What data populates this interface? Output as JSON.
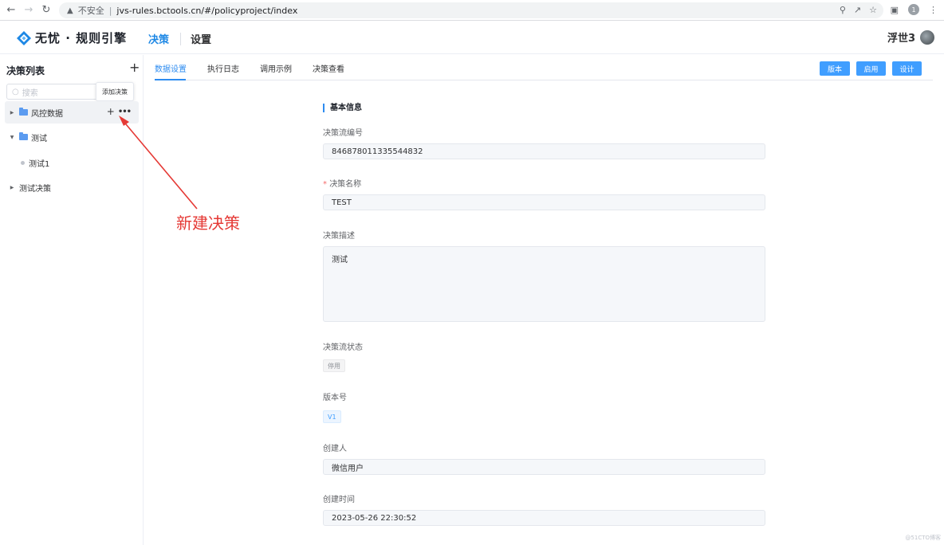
{
  "browser": {
    "insecure_label": "不安全",
    "url": "jvs-rules.bctools.cn/#/policyproject/index",
    "profile_initial": "1"
  },
  "header": {
    "logo_text": "无忧 · 规则引擎",
    "nav_active": "决策",
    "nav_settings": "设置",
    "user_name": "浮世3"
  },
  "sidebar": {
    "title": "决策列表",
    "search_placeholder": "搜索",
    "tooltip": "添加决策",
    "items": [
      {
        "label": "风控数据"
      },
      {
        "label": "测试"
      },
      {
        "label": "测试1"
      },
      {
        "label": "测试决策"
      }
    ]
  },
  "annotation": "新建决策",
  "tabs": [
    {
      "label": "数据设置"
    },
    {
      "label": "执行日志"
    },
    {
      "label": "调用示例"
    },
    {
      "label": "决策查看"
    }
  ],
  "buttons": {
    "version": "版本",
    "enable": "启用",
    "design": "设计"
  },
  "form": {
    "section_title": "基本信息",
    "flow_id_label": "决策流编号",
    "flow_id_value": "846878011335544832",
    "name_required": "*",
    "name_label": "决策名称",
    "name_value": "TEST",
    "desc_label": "决策描述",
    "desc_value": "测试",
    "status_label": "决策流状态",
    "status_value": "停用",
    "version_label": "版本号",
    "version_value": "V1",
    "creator_label": "创建人",
    "creator_value": "微信用户",
    "created_time_label": "创建时间",
    "created_time_value": "2023-05-26 22:30:52"
  },
  "watermark": "@51CTO博客"
}
